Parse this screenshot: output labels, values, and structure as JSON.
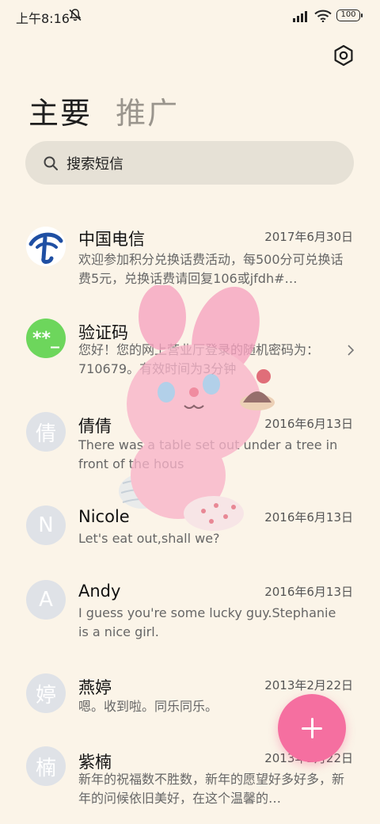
{
  "status_bar": {
    "time": "上午8:16",
    "battery": "100"
  },
  "tabs": [
    {
      "label": "主要",
      "active": true
    },
    {
      "label": "推广",
      "active": false
    }
  ],
  "search": {
    "placeholder": "搜索短信"
  },
  "conversations": [
    {
      "name": "中国电信",
      "date": "2017年6月30日",
      "preview": "欢迎参加积分兑换话费活动，每500分可兑换话费5元，兑换话费请回复106或jfdh#…",
      "avatar": {
        "type": "logo",
        "icon": "china-telecom-logo"
      }
    },
    {
      "name": "验证码",
      "date": "",
      "preview": "您好！您的网上营业厅登录的随机密码为：710679。有效时间为3分钟",
      "avatar": {
        "type": "green",
        "text": "**_"
      }
    },
    {
      "name": "倩倩",
      "date": "2016年6月13日",
      "preview": "There was a table set out under a tree in front of the hous",
      "avatar": {
        "type": "gray",
        "text": "倩"
      }
    },
    {
      "name": "Nicole",
      "date": "2016年6月13日",
      "preview": "Let's eat out,shall we?",
      "avatar": {
        "type": "gray",
        "text": "N"
      }
    },
    {
      "name": "Andy",
      "date": "2016年6月13日",
      "preview": "I guess you're some lucky guy.Stephanie is a nice girl.",
      "avatar": {
        "type": "gray",
        "text": "A"
      }
    },
    {
      "name": "燕婷",
      "date": "2013年2月22日",
      "preview": "嗯。收到啦。同乐同乐。",
      "avatar": {
        "type": "gray",
        "text": "婷"
      }
    },
    {
      "name": "紫楠",
      "date": "2013年2月22日",
      "preview": "新年的祝福数不胜数，新年的愿望好多好多，新年的问候依旧美好，在这个温馨的…",
      "avatar": {
        "type": "gray",
        "text": "楠"
      }
    }
  ],
  "colors": {
    "background": "#fbf4e8",
    "fab": "#f56fa0",
    "avatar_gray": "#dfe2e7",
    "avatar_green": "#6dd65c"
  },
  "icons": {
    "settings": "gear-icon",
    "search": "search-icon",
    "compose": "plus-icon"
  }
}
